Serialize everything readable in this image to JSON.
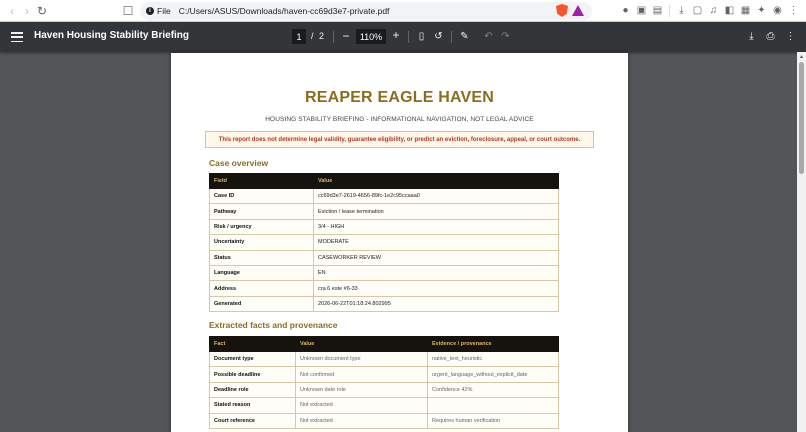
{
  "browser": {
    "address_scheme_label": "File",
    "address_url": "C:/Users/ASUS/Downloads/haven-cc69d3e7-private.pdf"
  },
  "viewer": {
    "title": "Haven Housing Stability Briefing",
    "page_current": "1",
    "page_separator": "/",
    "page_total": "2",
    "zoom": "110%"
  },
  "doc": {
    "brand": "REAPER EAGLE HAVEN",
    "subtitle": "HOUSING STABILITY BRIEFING - INFORMATIONAL NAVIGATION, NOT LEGAL ADVICE",
    "warning": "This report does not determine legal validity, guarantee eligibility, or predict an eviction, foreclosure, appeal, or court outcome.",
    "case_overview": {
      "title": "Case overview",
      "headers": [
        "Field",
        "Value"
      ],
      "rows": [
        [
          "Case ID",
          "cc69d3e7-2619-4656-89fc-1e2c95ccaaa0"
        ],
        [
          "Pathway",
          "Eviction / lease termination"
        ],
        [
          "Risk / urgency",
          "3/4 - HIGH"
        ],
        [
          "Uncertainty",
          "MODERATE"
        ],
        [
          "Status",
          "CASEWORKER REVIEW"
        ],
        [
          "Language",
          "EN"
        ],
        [
          "Address",
          "cra 6 este #6-33"
        ],
        [
          "Generated",
          "2026-06-22T01:18:24.802995"
        ]
      ]
    },
    "facts": {
      "title": "Extracted facts and provenance",
      "headers": [
        "Fact",
        "Value",
        "Evidence / provenance"
      ],
      "rows": [
        [
          "Document type",
          "Unknown document type",
          "native_text_heuristic"
        ],
        [
          "Possible deadline",
          "Not confirmed",
          "urgent_language_without_explicit_date"
        ],
        [
          "Deadline role",
          "Unknown date role",
          "Confidence 42%"
        ],
        [
          "Stated reason",
          "Not extracted",
          ""
        ],
        [
          "Court reference",
          "Not extracted",
          "Requires human verification"
        ]
      ]
    }
  }
}
